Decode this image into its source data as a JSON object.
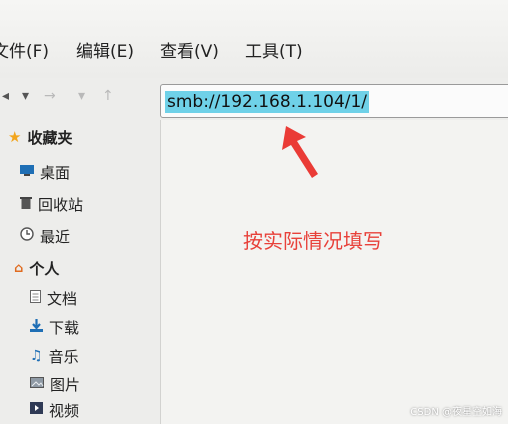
{
  "menu": [
    {
      "label": "文件(F)"
    },
    {
      "label": "编辑(E)"
    },
    {
      "label": "查看(V)"
    },
    {
      "label": "工具(T)"
    }
  ],
  "location": {
    "value": "smb://192.168.1.104/1/"
  },
  "sidebar": {
    "bookmarks_header": "收藏夹",
    "bookmarks": [
      {
        "label": "桌面",
        "icon": "desktop-icon"
      },
      {
        "label": "回收站",
        "icon": "trash-icon"
      },
      {
        "label": "最近",
        "icon": "clock-icon"
      }
    ],
    "personal_header": "个人",
    "personal": [
      {
        "label": "文档",
        "icon": "document-icon"
      },
      {
        "label": "下载",
        "icon": "download-icon"
      },
      {
        "label": "音乐",
        "icon": "music-icon"
      },
      {
        "label": "图片",
        "icon": "picture-icon"
      },
      {
        "label": "视频",
        "icon": "video-icon"
      }
    ]
  },
  "annotation": {
    "text": "按实际情况填写",
    "color": "#e8413a"
  },
  "watermark": {
    "text": "CSDN @夜星空如海"
  },
  "colors": {
    "selection": "#6fd1e8",
    "accent_red": "#e8413a",
    "bookmark_star": "#f2a51c",
    "home_orange": "#e06b1f"
  }
}
